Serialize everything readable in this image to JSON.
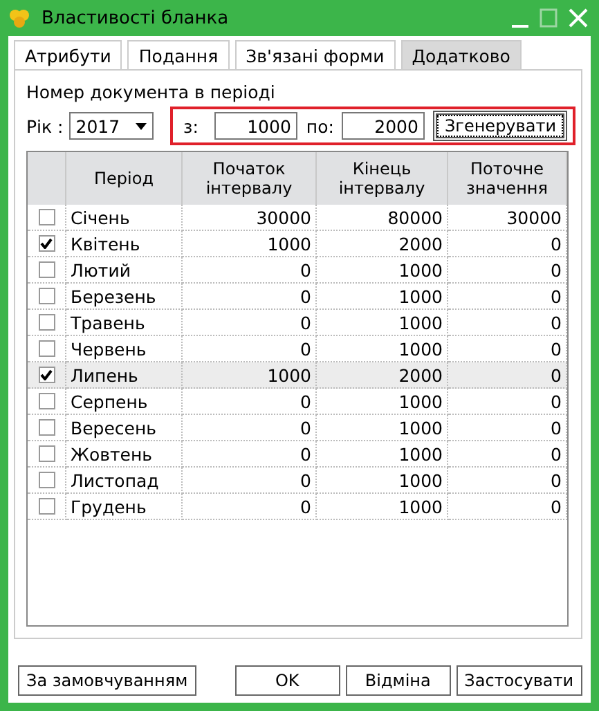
{
  "window": {
    "title": "Властивості бланка"
  },
  "tabs": [
    {
      "label": "Атрибути",
      "selected": false
    },
    {
      "label": "Подання",
      "selected": false
    },
    {
      "label": "Зв'язані форми",
      "selected": false
    },
    {
      "label": "Додатково",
      "selected": true
    }
  ],
  "section_title": "Номер документа в періоді",
  "year": {
    "label": "Рік :",
    "value": "2017"
  },
  "range": {
    "from_label": "з:",
    "from_value": "1000",
    "to_label": "по:",
    "to_value": "2000",
    "generate_button": "Згенерувати"
  },
  "table": {
    "columns": [
      "Період",
      "Початок інтервалу",
      "Кінець інтервалу",
      "Поточне значення"
    ],
    "rows": [
      {
        "checked": false,
        "selected": false,
        "period": "Січень",
        "start": "30000",
        "end": "80000",
        "current": "30000"
      },
      {
        "checked": true,
        "selected": false,
        "period": "Квітень",
        "start": "1000",
        "end": "2000",
        "current": "0"
      },
      {
        "checked": false,
        "selected": false,
        "period": "Лютий",
        "start": "0",
        "end": "1000",
        "current": "0"
      },
      {
        "checked": false,
        "selected": false,
        "period": "Березень",
        "start": "0",
        "end": "1000",
        "current": "0"
      },
      {
        "checked": false,
        "selected": false,
        "period": "Травень",
        "start": "0",
        "end": "1000",
        "current": "0"
      },
      {
        "checked": false,
        "selected": false,
        "period": "Червень",
        "start": "0",
        "end": "1000",
        "current": "0"
      },
      {
        "checked": true,
        "selected": true,
        "period": "Липень",
        "start": "1000",
        "end": "2000",
        "current": "0"
      },
      {
        "checked": false,
        "selected": false,
        "period": "Серпень",
        "start": "0",
        "end": "1000",
        "current": "0"
      },
      {
        "checked": false,
        "selected": false,
        "period": "Вересень",
        "start": "0",
        "end": "1000",
        "current": "0"
      },
      {
        "checked": false,
        "selected": false,
        "period": "Жовтень",
        "start": "0",
        "end": "1000",
        "current": "0"
      },
      {
        "checked": false,
        "selected": false,
        "period": "Листопад",
        "start": "0",
        "end": "1000",
        "current": "0"
      },
      {
        "checked": false,
        "selected": false,
        "period": "Грудень",
        "start": "0",
        "end": "1000",
        "current": "0"
      }
    ]
  },
  "buttons": {
    "defaults": "За замовчуванням",
    "ok": "OK",
    "cancel": "Відміна",
    "apply": "Застосувати"
  }
}
